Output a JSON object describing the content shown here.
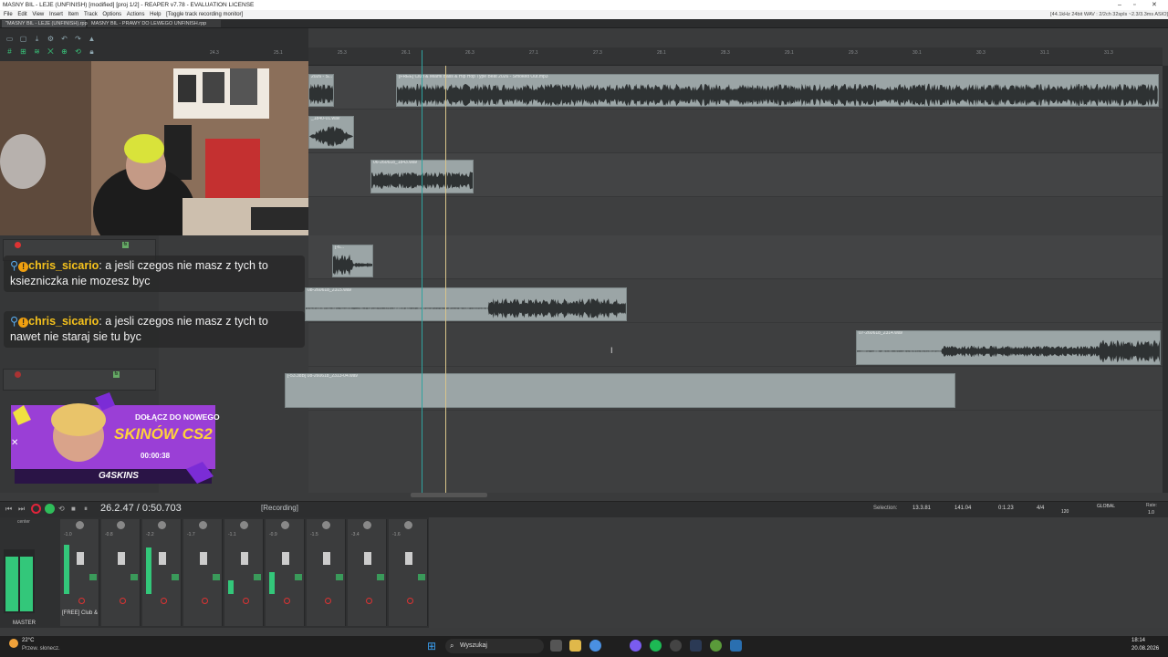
{
  "window": {
    "title": "MASNY BIL - LEJE (UNFINISH) [modified] [proj 1/2] - REAPER v7.78 - EVALUATION LICENSE",
    "status": "[44.1kHz 24bit WAV : 2/2ch 32spls ~2.3/3.3ms ASIO]"
  },
  "menu": [
    "File",
    "Edit",
    "View",
    "Insert",
    "Item",
    "Track",
    "Options",
    "Actions",
    "Help",
    "[Toggle track recording monitor]"
  ],
  "tabs": [
    "\"MASNY BIL - LEJE (UNFINISH).rpp",
    "MASNY BIL - PRAWY DO LEWEGO UNFINISH.rpp"
  ],
  "ruler": [
    "24.3",
    "25.1",
    "25.3",
    "26.1",
    "26.3",
    "27.1",
    "27.3",
    "28.1",
    "28.3",
    "29.1",
    "29.3",
    "30.1",
    "30.3",
    "31.1",
    "31.3",
    "32.1"
  ],
  "items": {
    "beat": "[FREE] Club & Miami Bass & Hip Hop Type Beat 2026 - Smoked Out.mp3",
    "a": "2026 - S...",
    "b": "_1840-01.wav",
    "c": "06-260618_1843.wav",
    "d": "[-6...",
    "e": "08-260618_2315.wav",
    "f": "07-260618_2314.wav",
    "g": "[-53.3dB] 08-260618_2313-04.wav"
  },
  "chat": [
    {
      "user": "chris_sicario",
      "text": "a jesli czegos nie masz z tych to ksiezniczka nie mozesz byc"
    },
    {
      "user": "chris_sicario",
      "text": "a jesli czegos nie masz z tych to nawet nie staraj sie tu byc"
    }
  ],
  "ad": {
    "line1": "DOŁĄCZ DO NOWEGO",
    "line2": "SKINÓW CS2",
    "timer": "00:00:38",
    "brand": "G4SKINS"
  },
  "transport": {
    "time": "26.2.47 / 0:50.703",
    "state": "[Recording]",
    "sel_label": "Selection:",
    "sel_start": "13.3.81",
    "sel_end": "141.04",
    "sel_len": "0:1.23",
    "sig": "4/4",
    "bpm": "120",
    "rate_label": "Rate:",
    "rate": "1.0",
    "global": "GLOBAL"
  },
  "mixer": {
    "master": "MASTER",
    "track1": "[FREE] Club &",
    "center": "center",
    "vals": [
      "-1.0",
      "-0.8",
      "-2.2",
      "-1.7",
      "-1.1",
      "-0.9",
      "-1.5",
      "-3.4",
      "-1.6"
    ]
  },
  "taskbar": {
    "weather_temp": "22°C",
    "weather_text": "Przew. słonecz.",
    "search": "Wyszukaj",
    "time": "18:14",
    "date": "20.08.2026"
  },
  "colors": {
    "accent": "#2fa3a0",
    "item": "#9ba5a6",
    "rec": "#e0243a"
  }
}
